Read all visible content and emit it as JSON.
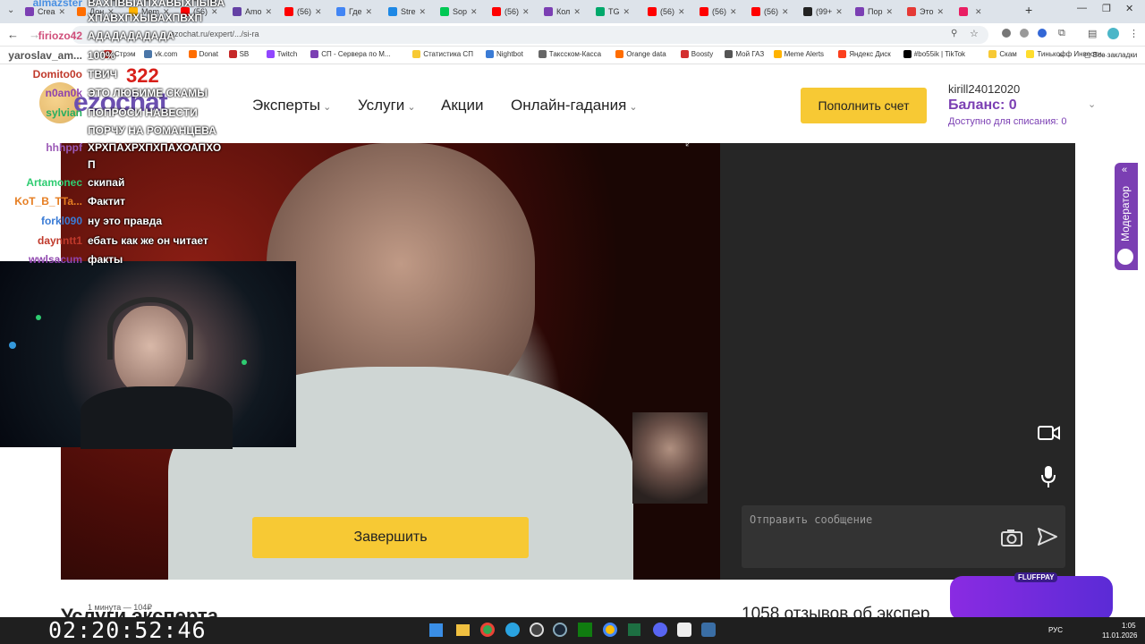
{
  "browser": {
    "tabs": [
      {
        "label": "Crea",
        "color": "#7b3fb3"
      },
      {
        "label": "Дон",
        "color": "#ff6d00"
      },
      {
        "label": "Mem",
        "color": "#ffb300"
      },
      {
        "label": "(56)",
        "color": "#ff0000"
      },
      {
        "label": "Amo",
        "color": "#6441a5"
      },
      {
        "label": "(56)",
        "color": "#ff0000"
      },
      {
        "label": "Где",
        "color": "#4285f4"
      },
      {
        "label": "Stre",
        "color": "#1e88e5"
      },
      {
        "label": "Sop",
        "color": "#00c853"
      },
      {
        "label": "(56)",
        "color": "#ff0000"
      },
      {
        "label": "Кол",
        "color": "#7b3fb3"
      },
      {
        "label": "TG",
        "color": "#00a86b"
      },
      {
        "label": "(56)",
        "color": "#ff0000"
      },
      {
        "label": "(56)",
        "color": "#ff0000"
      },
      {
        "label": "(56)",
        "color": "#ff0000"
      },
      {
        "label": "(99+",
        "color": "#222222"
      },
      {
        "label": "Пор",
        "color": "#7b3fb3"
      },
      {
        "label": "Это",
        "color": "#e53935"
      },
      {
        "label": "",
        "color": "#e91e63"
      }
    ],
    "url": "ezochat.ru/expert/.../si-ra",
    "bookmarks": [
      "Стрэм",
      "vk.com",
      "Donat",
      "SB",
      "Twitch",
      "СП - Сервера по М...",
      "Статистика СП",
      "Nightbot",
      "Таксском-Касса",
      "Orange data",
      "Boosty",
      "Мой ГАЗ",
      "Meme Alerts",
      "Яндекс Диск",
      "#bo55ik | TikTok",
      "Скам",
      "Тинькофф Инвести..."
    ],
    "all_bookmarks": "Все закладки"
  },
  "site": {
    "logo": "ezochat",
    "nav": [
      {
        "label": "Эксперты",
        "has_menu": true
      },
      {
        "label": "Услуги",
        "has_menu": true
      },
      {
        "label": "Акции",
        "has_menu": false
      },
      {
        "label": "Онлайн-гадания",
        "has_menu": true
      }
    ],
    "topup_label": "Пополнить счет",
    "user": {
      "name": "kirill24012020",
      "balance_label": "Баланс: 0",
      "available_label": "Доступно для списания: 0"
    },
    "end_button": "Завершить",
    "message_placeholder": "Отправить сообщение",
    "moderator_label": "Модератор",
    "below_left": "Услуги эксперта",
    "below_right": "1058 отзывов об экспер",
    "below_small": "1 минута — 104₽"
  },
  "stream_chat": [
    {
      "user": "almazster",
      "color": "#4a90e2",
      "msg": "ВАХПВЫАПХАВЫХПЫВА"
    },
    {
      "user": "",
      "color": "#4a90e2",
      "msg": "ХПАВХПХЫВАХПВХП"
    },
    {
      "user": "firiozo42",
      "color": "#d04e7a",
      "msg": "АДАДАДАДАДА"
    },
    {
      "user": "yaroslav_am...",
      "color": "#555555",
      "msg": "100%"
    },
    {
      "user": "Domito0o",
      "color": "#c0392b",
      "msg": "ТВИЧ"
    },
    {
      "user": "n0an0k",
      "color": "#8e44ad",
      "msg": "ЭТО ЛЮБИМЕ СКАМЫ"
    },
    {
      "user": "sylvian",
      "color": "#27ae60",
      "msg": "ПОПРОСИ НАВЕСТИ"
    },
    {
      "user": "",
      "color": "#27ae60",
      "msg": "ПОРЧУ НА РОМАНЦЕВА"
    },
    {
      "user": "hhhppf",
      "color": "#9b59b6",
      "msg": "ХРХПАХРХПХПАХОАПХО"
    },
    {
      "user": "",
      "color": "#9b59b6",
      "msg": "П"
    },
    {
      "user": "Artamonec",
      "color": "#2ecc71",
      "msg": "скипай"
    },
    {
      "user": "KoT_B_TTa...",
      "color": "#e67e22",
      "msg": "Фактит"
    },
    {
      "user": "forkl090",
      "color": "#3a7bd5",
      "msg": "ну это правда"
    },
    {
      "user": "daynntt1",
      "color": "#c0392b",
      "msg": "ебать как же он читает"
    },
    {
      "user": "wwlsacum",
      "color": "#8e44ad",
      "msg": "факты"
    }
  ],
  "donation_count": "322",
  "stream_timer": "02:20:52:46",
  "taskbar": {
    "lang": "РУС",
    "time": "1:05",
    "date": "11.01.2026"
  },
  "fluffpay_label": "FLUFFPAY",
  "colors": {
    "accent_yellow": "#f7c934",
    "brand_purple": "#7b3fb3",
    "dark_panel": "#262626"
  }
}
